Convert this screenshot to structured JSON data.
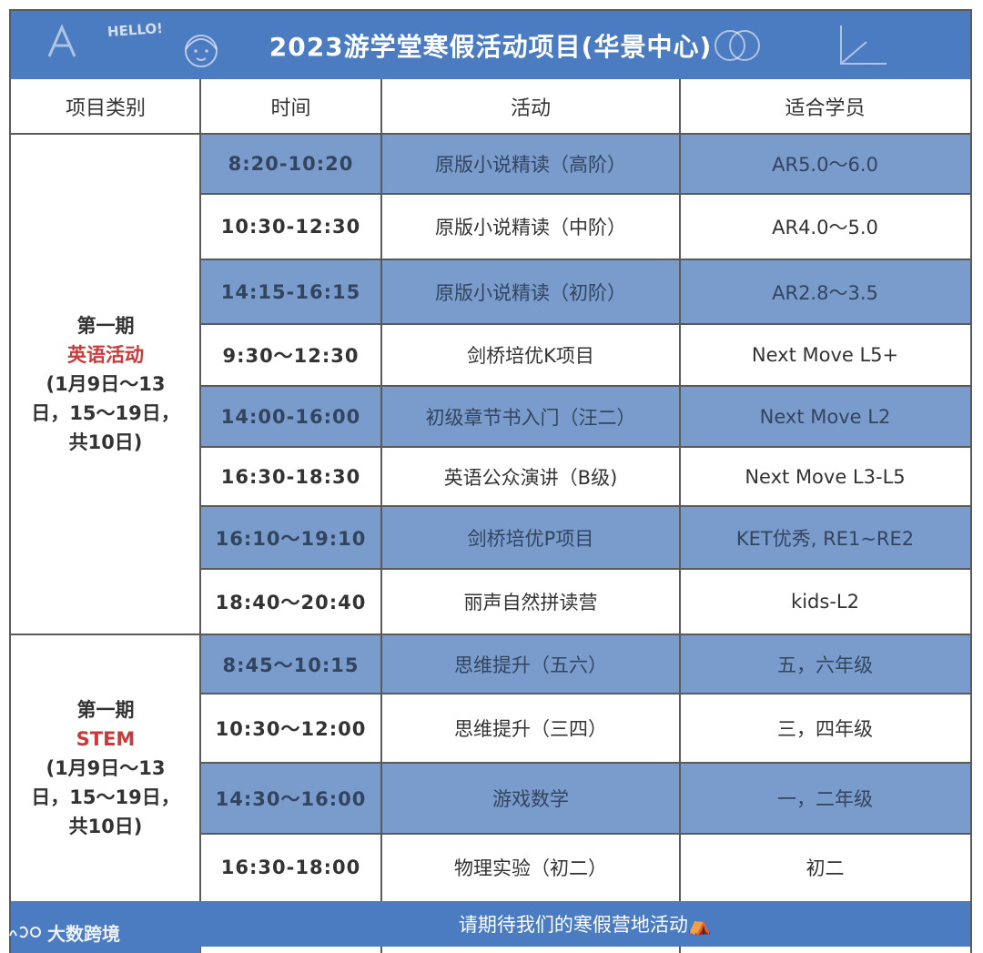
{
  "title": "2023游学堂寒假活动项目(华景中心)",
  "doodle_hello": "HELLO!",
  "headers": [
    "项目类别",
    "时间",
    "活动",
    "适合学员"
  ],
  "groups": [
    {
      "period": "第一期",
      "subject": "英语活动",
      "dates_lines": [
        "(1月9日～13",
        "日，15～19日，",
        "共10日)"
      ]
    },
    {
      "period": "第一期",
      "subject": "STEM",
      "dates_lines": [
        "(1月9日～13",
        "日，15～19日，",
        "共10日)"
      ]
    }
  ],
  "rows": [
    {
      "time": "8:20-10:20",
      "activity": "原版小说精读（高阶）",
      "students": "AR5.0～6.0"
    },
    {
      "time": "10:30-12:30",
      "activity": "原版小说精读（中阶）",
      "students": "AR4.0～5.0"
    },
    {
      "time": "14:15-16:15",
      "activity": "原版小说精读（初阶）",
      "students": "AR2.8～3.5"
    },
    {
      "time": "9:30～12:30",
      "activity": "剑桥培优K项目",
      "students": "Next Move L5+"
    },
    {
      "time": "14:00-16:00",
      "activity": "初级章节书入门（汪二）",
      "students": "Next Move L2"
    },
    {
      "time": "16:30-18:30",
      "activity": "英语公众演讲（B级)",
      "students": "Next Move L3-L5"
    },
    {
      "time": "16:10～19:10",
      "activity": "剑桥培优P项目",
      "students": "KET优秀, RE1~RE2"
    },
    {
      "time": "18:40～20:40",
      "activity": "丽声自然拼读营",
      "students": "kids-L2"
    },
    {
      "time": "8:45～10:15",
      "activity": "思维提升（五六）",
      "students": "五，六年级"
    },
    {
      "time": "10:30～12:00",
      "activity": "思维提升（三四）",
      "students": "三，四年级"
    },
    {
      "time": "14:30～16:00",
      "activity": "游戏数学",
      "students": "一，二年级"
    },
    {
      "time": "16:30-18:00",
      "activity": "物理实验（初二）",
      "students": "初二"
    }
  ],
  "footer": "请期待我们的寒假营地活动⛺",
  "watermark": "大数跨境",
  "colors": {
    "header_blue": "#4b7cc2",
    "row_blue": "#7a9ccd",
    "highlight_red": "#c93b3b"
  }
}
